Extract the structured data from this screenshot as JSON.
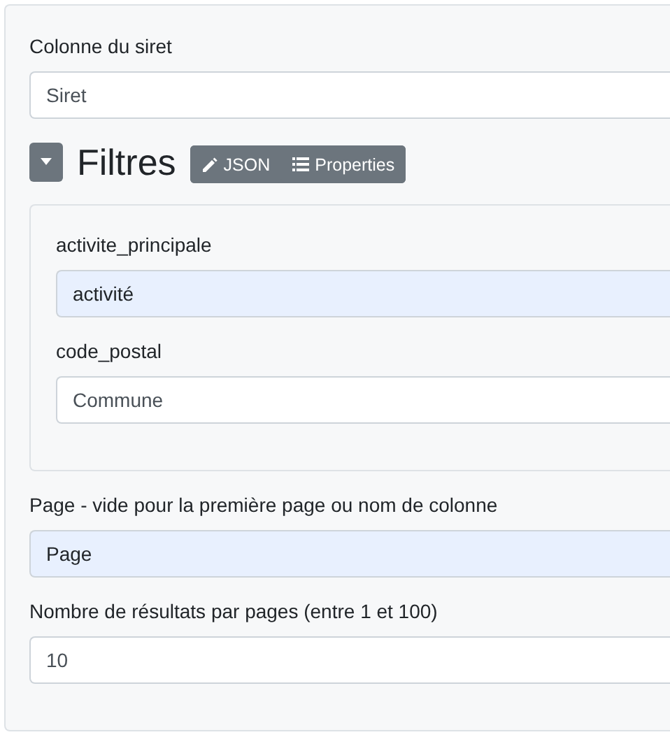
{
  "fields_top": [
    {
      "label": "Colonne du siret",
      "value": "Siret",
      "autofilled": false
    }
  ],
  "filters": {
    "expanded": true,
    "title": "Filtres",
    "buttons": [
      {
        "kind": "pencil",
        "label": "JSON"
      },
      {
        "kind": "list",
        "label": "Properties"
      }
    ],
    "fields": [
      {
        "label": "activite_principale",
        "value": "activité",
        "autofilled": true
      },
      {
        "label": "code_postal",
        "value": "Commune",
        "autofilled": false
      }
    ]
  },
  "fields_bottom": [
    {
      "label": "Page - vide pour la première page ou nom de colonne",
      "value": "Page",
      "autofilled": true
    },
    {
      "label": "Nombre de résultats par pages (entre 1 et 100)",
      "value": "10",
      "autofilled": false
    }
  ]
}
